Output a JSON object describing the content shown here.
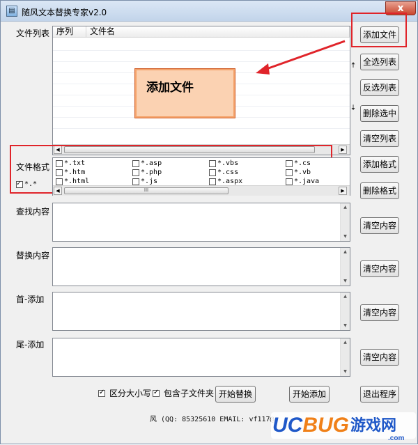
{
  "window": {
    "title": "随风文本替换专家v2.0",
    "close_glyph": "x"
  },
  "file_list": {
    "label": "文件列表",
    "columns": [
      "序列",
      "文件名"
    ],
    "scroll_thumb": "",
    "buttons": {
      "add_file": "添加文件",
      "select_all": "全选列表",
      "invert": "反选列表",
      "delete": "删除选中",
      "clear": "清空列表"
    }
  },
  "callout": {
    "text": "添加文件"
  },
  "formats": {
    "label": "文件格式",
    "all_label": "*.*",
    "options": [
      [
        "*.txt",
        "*.asp",
        "*.vbs",
        "*.cs"
      ],
      [
        "*.htm",
        "*.php",
        "*.css",
        "*.vb"
      ],
      [
        "*.html",
        "*.js",
        "*.aspx",
        "*.java"
      ]
    ],
    "scroll_thumb": "III",
    "buttons": {
      "add": "添加格式",
      "delete": "删除格式"
    }
  },
  "sections": {
    "find": {
      "label": "查找内容",
      "clear": "清空内容"
    },
    "replace": {
      "label": "替换内容",
      "clear": "清空内容"
    },
    "head": {
      "label": "首-添加",
      "clear": "清空内容"
    },
    "tail": {
      "label": "尾-添加",
      "clear": "清空内容"
    }
  },
  "options": {
    "case_sensitive": "区分大小写",
    "include_subfolders": "包含子文件夹",
    "start_replace": "开始替换",
    "start_add": "开始添加",
    "exit": "退出程序"
  },
  "status": {
    "text": "风 (QQ: 85325610 EMAIL: vf117@"
  },
  "watermark": {
    "brand": "UCBUG",
    "suffix": "游戏网",
    "domain": ".com"
  },
  "colors": {
    "accent_red": "#e0242a",
    "callout_fill": "#fbd2b2",
    "brand_blue": "#1f58c8",
    "brand_orange": "#f08018"
  }
}
